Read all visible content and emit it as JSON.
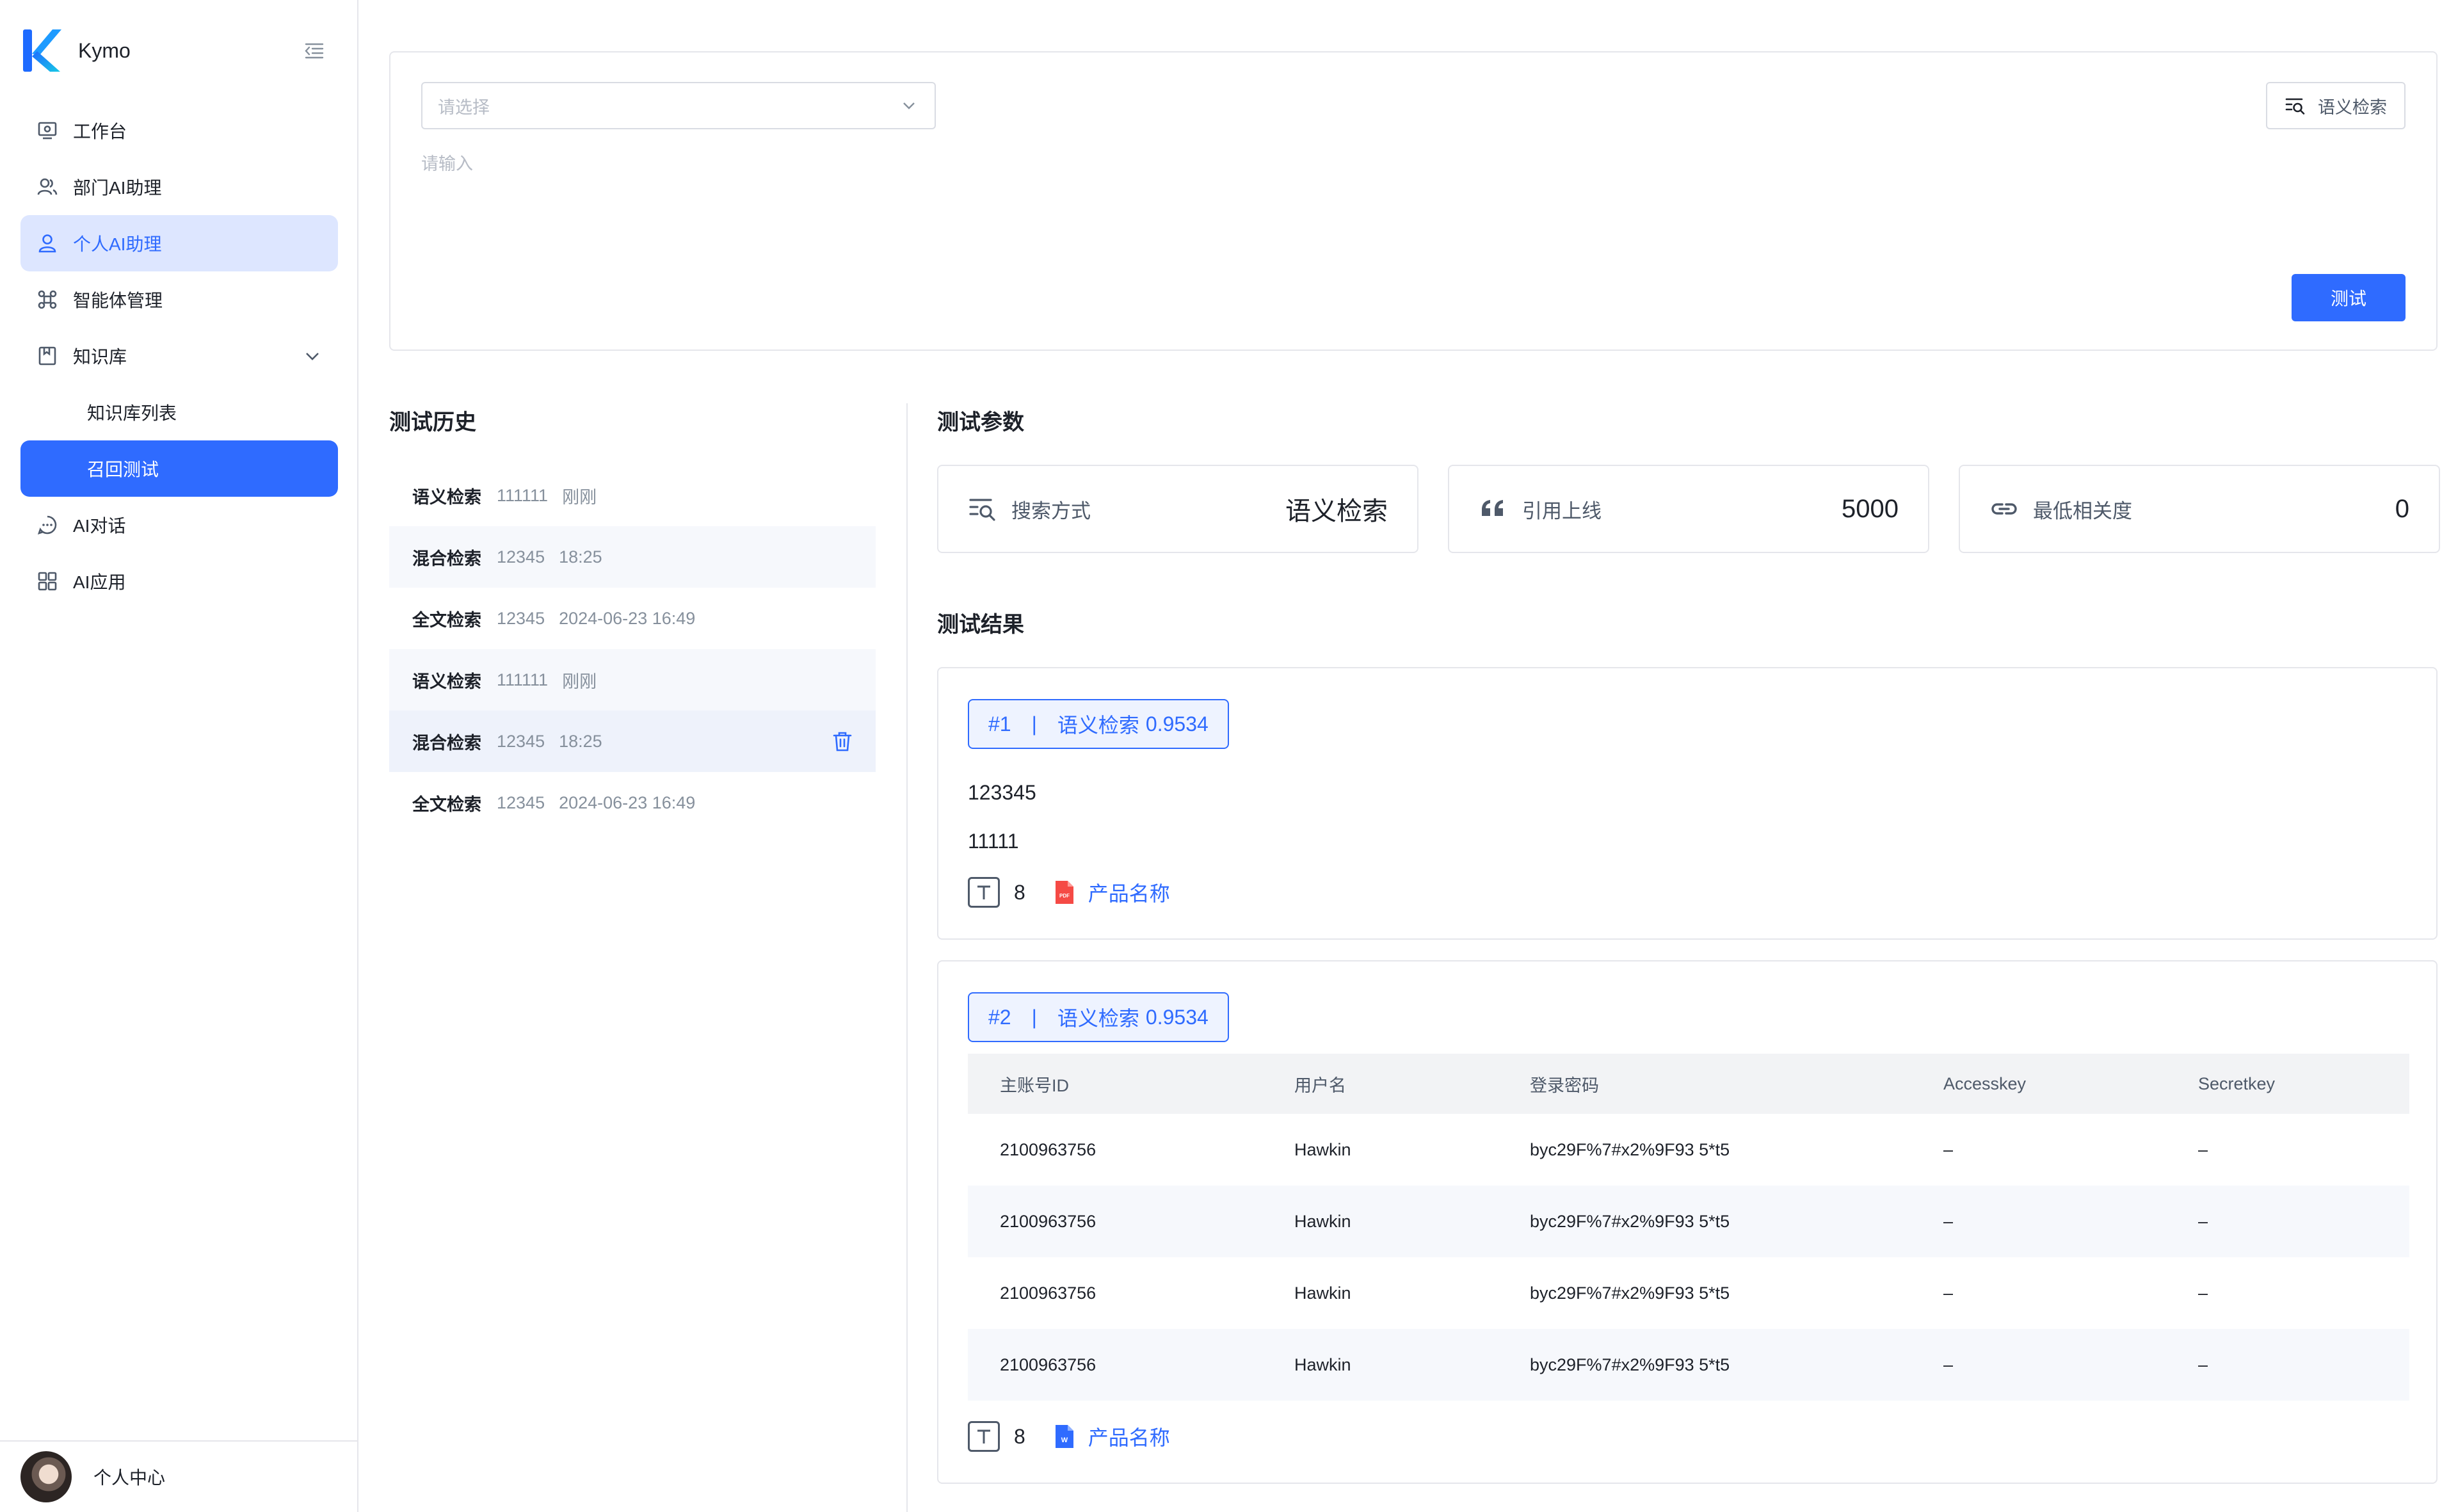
{
  "app": {
    "name": "Kymo"
  },
  "sidebar": {
    "items": [
      {
        "label": "工作台",
        "icon": "monitor-icon"
      },
      {
        "label": "部门AI助理",
        "icon": "users-icon"
      },
      {
        "label": "个人AI助理",
        "icon": "user-icon"
      },
      {
        "label": "智能体管理",
        "icon": "command-icon"
      },
      {
        "label": "知识库",
        "icon": "book-icon"
      },
      {
        "label": "知识库列表"
      },
      {
        "label": "召回测试"
      },
      {
        "label": "AI对话",
        "icon": "chat-icon"
      },
      {
        "label": "AI应用",
        "icon": "grid-icon"
      }
    ],
    "user_label": "个人中心"
  },
  "query": {
    "select_placeholder": "请选择",
    "input_placeholder": "请输入",
    "mode_button": "语义检索",
    "test_button": "测试"
  },
  "history": {
    "title": "测试历史",
    "items": [
      {
        "mode": "语义检索",
        "query": "111111",
        "time": "刚刚"
      },
      {
        "mode": "混合检索",
        "query": "12345",
        "time": "18:25"
      },
      {
        "mode": "全文检索",
        "query": "12345",
        "time": "2024-06-23  16:49"
      },
      {
        "mode": "语义检索",
        "query": "111111",
        "time": "刚刚"
      },
      {
        "mode": "混合检索",
        "query": "12345",
        "time": "18:25"
      },
      {
        "mode": "全文检索",
        "query": "12345",
        "time": "2024-06-23  16:49"
      }
    ]
  },
  "params": {
    "title": "测试参数",
    "search_mode": {
      "label": "搜索方式",
      "value": "语义检索"
    },
    "quote_limit": {
      "label": "引用上线",
      "value": "5000"
    },
    "min_relevance": {
      "label": "最低相关度",
      "value": "0"
    }
  },
  "results": {
    "title": "测试结果",
    "items": [
      {
        "rank": "#1",
        "mode": "语义检索",
        "score": "0.9534",
        "lines": [
          "123345",
          "11111"
        ],
        "token_count": "8",
        "file_name": "产品名称",
        "file_type": "pdf"
      },
      {
        "rank": "#2",
        "mode": "语义检索",
        "score": "0.9534",
        "table": {
          "headers": [
            "主账号ID",
            "用户名",
            "登录密码",
            "Accesskey",
            "Secretkey"
          ],
          "rows": [
            [
              "2100963756",
              "Hawkin",
              "byc29F%7#x2%9F93 5*t5",
              "–",
              "–"
            ],
            [
              "2100963756",
              "Hawkin",
              "byc29F%7#x2%9F93 5*t5",
              "–",
              "–"
            ],
            [
              "2100963756",
              "Hawkin",
              "byc29F%7#x2%9F93 5*t5",
              "–",
              "–"
            ],
            [
              "2100963756",
              "Hawkin",
              "byc29F%7#x2%9F93 5*t5",
              "–",
              "–"
            ]
          ]
        },
        "token_count": "8",
        "file_name": "产品名称",
        "file_type": "word"
      }
    ]
  },
  "colors": {
    "primary": "#2f6bff",
    "active_soft": "#dde6ff",
    "border": "#e5e6eb"
  }
}
